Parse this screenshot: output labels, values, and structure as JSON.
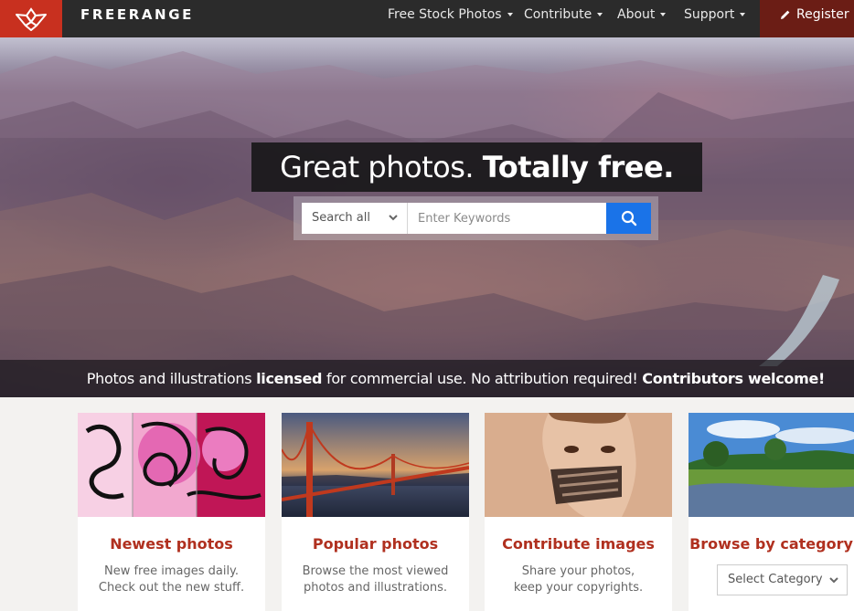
{
  "brand": {
    "name": "FREERANGE",
    "logo_icon": "freerange-bird-logo-icon",
    "color": "#c8301f"
  },
  "nav": {
    "items": [
      {
        "label": "Free Stock Photos"
      },
      {
        "label": "Contribute"
      },
      {
        "label": "About"
      },
      {
        "label": "Support"
      }
    ],
    "register_label": "Register",
    "register_icon": "pencil-icon"
  },
  "hero": {
    "headline_regular": "Great photos. ",
    "headline_bold": "Totally free.",
    "search": {
      "scope_value": "Search all",
      "placeholder": "Enter Keywords",
      "button_icon": "search-icon",
      "button_color": "#1a73e8"
    },
    "tagline": {
      "part1": "Photos and illustrations ",
      "part2_bold": "licensed",
      "part3": " for commercial use. No attribution required! ",
      "part4_bold": "Contributors welcome!"
    }
  },
  "cards": [
    {
      "title": "Newest photos",
      "line1": "New free images daily.",
      "line2": "Check out the new stuff."
    },
    {
      "title": "Popular photos",
      "line1": "Browse the most viewed",
      "line2": "photos and illustrations."
    },
    {
      "title": "Contribute images",
      "line1": "Share your photos,",
      "line2": "keep your copyrights."
    },
    {
      "title": "Browse by category",
      "select_value": "Select Category"
    }
  ]
}
